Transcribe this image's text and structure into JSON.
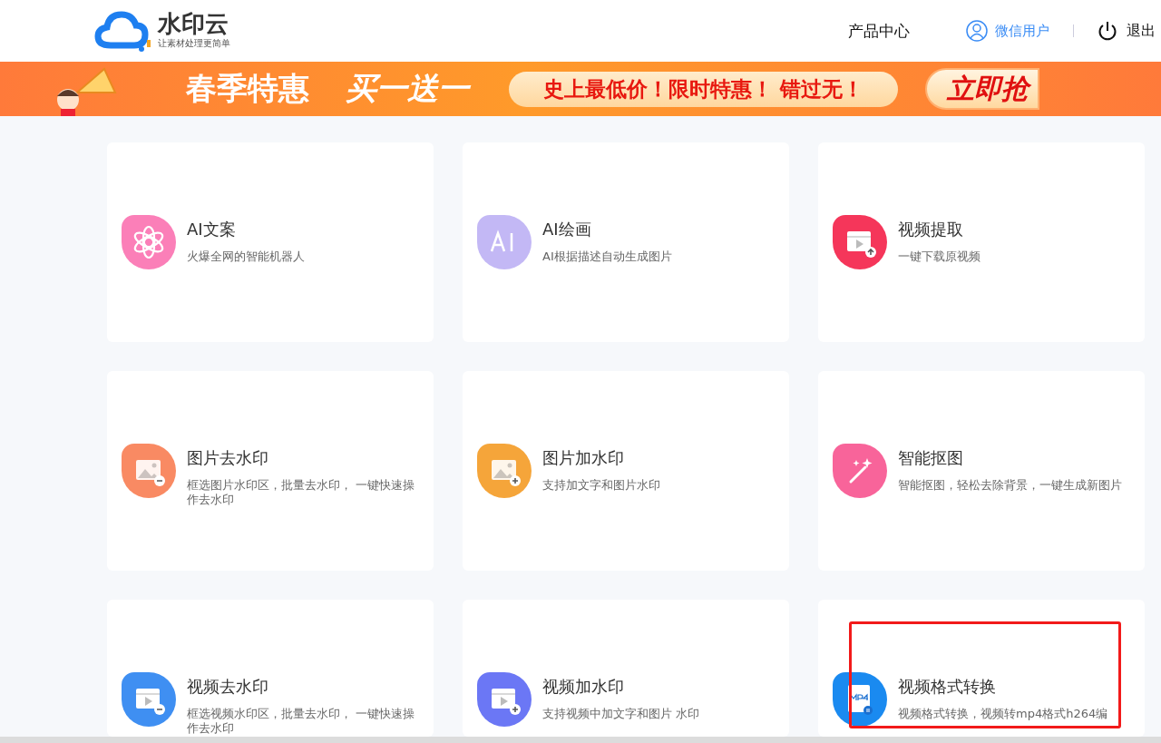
{
  "header": {
    "logo_name": "水印云",
    "logo_slogan": "让素材处理更简单",
    "nav": [
      {
        "label": "产品中心",
        "kind": "link"
      },
      {
        "label": "微信用户",
        "kind": "user"
      },
      {
        "label": "退出",
        "kind": "logout"
      }
    ]
  },
  "banner": {
    "title": "春季特惠",
    "offer": "买一送一",
    "slogan": "史上最低价！限时特惠！ 错过无！",
    "button": "立即抢"
  },
  "cards": [
    {
      "title": "AI文案",
      "description": "火爆全网的智能机器人",
      "kind": "knot",
      "color": "#fb7fb8",
      "highlighted": false
    },
    {
      "title": "AI绘画",
      "description": "AI根据描述自动生成图片",
      "kind": "ai",
      "color": "#c3b8f5",
      "highlighted": false
    },
    {
      "title": "视频提取",
      "description": "一键下载原视频",
      "kind": "video-up",
      "color": "#f5365a",
      "highlighted": false
    },
    {
      "title": "图片去水印",
      "description": "框选图片水印区，批量去水印， 一键快速操作去水印",
      "kind": "image-minus",
      "color": "#f98a63",
      "highlighted": false
    },
    {
      "title": "图片加水印",
      "description": "支持加文字和图片水印",
      "kind": "image-plus",
      "color": "#f5a53a",
      "highlighted": false
    },
    {
      "title": "智能抠图",
      "description": "智能抠图，轻松去除背景，一键生成新图片",
      "kind": "wand",
      "color": "#f8649a",
      "highlighted": false
    },
    {
      "title": "视频去水印",
      "description": "框选视频水印区，批量去水印， 一键快速操作去水印",
      "kind": "video-minus",
      "color": "#3f8ff2",
      "highlighted": false
    },
    {
      "title": "视频加水印",
      "description": "支持视频中加文字和图片 水印",
      "kind": "video-plus",
      "color": "#6b77f5",
      "highlighted": false
    },
    {
      "title": "视频格式转换",
      "description": "视频格式转换，视频转mp4格式h264编",
      "kind": "mp4",
      "color": "#1a8af0",
      "highlighted": true
    }
  ]
}
